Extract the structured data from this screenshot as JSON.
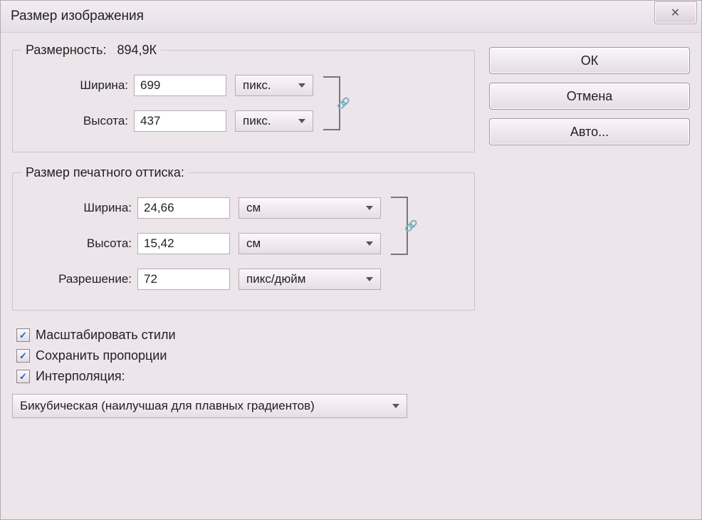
{
  "window": {
    "title": "Размер изображения"
  },
  "buttons": {
    "ok": "ОК",
    "cancel": "Отмена",
    "auto": "Авто..."
  },
  "dim": {
    "legend": "Размерность:",
    "size_text": "894,9К",
    "width_label": "Ширина:",
    "width_value": "699",
    "width_unit": "пикс.",
    "height_label": "Высота:",
    "height_value": "437",
    "height_unit": "пикс."
  },
  "print": {
    "legend": "Размер печатного оттиска:",
    "width_label": "Ширина:",
    "width_value": "24,66",
    "width_unit": "см",
    "height_label": "Высота:",
    "height_value": "15,42",
    "height_unit": "см",
    "res_label": "Разрешение:",
    "res_value": "72",
    "res_unit": "пикс/дюйм"
  },
  "checks": {
    "scale_styles": "Масштабировать стили",
    "constrain": "Сохранить пропорции",
    "resample": "Интерполяция:"
  },
  "resample_method": "Бикубическая (наилучшая для плавных градиентов)"
}
